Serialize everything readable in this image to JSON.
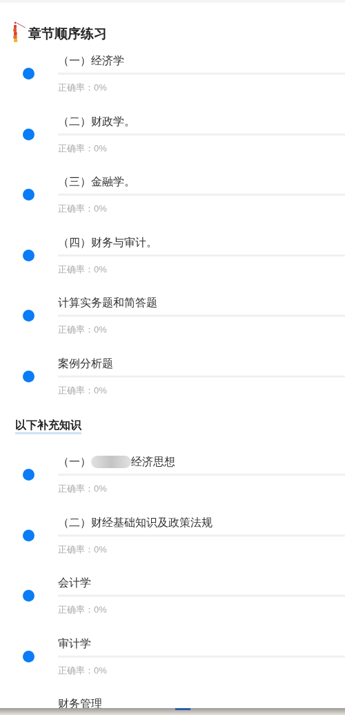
{
  "header": {
    "title": "章节顺序练习"
  },
  "chapters": [
    {
      "title_parts": [
        "（一）经济学"
      ],
      "track": {
        "level": 0
      },
      "accuracy": "正确率：0%"
    },
    {
      "title_parts": [
        "（二）财政学。"
      ],
      "track": {
        "level": 0
      },
      "accuracy": "正确率：0%"
    },
    {
      "title_parts": [
        "（三）金融学。"
      ],
      "track": {
        "level": 0
      },
      "accuracy": "正确率：0%"
    },
    {
      "title_parts": [
        "（四）财务与审计。"
      ],
      "track": {
        "level": 0
      },
      "accuracy": "正确率：0%"
    },
    {
      "title_parts": [
        "计算实务题和简答题"
      ],
      "track": {
        "level": 0
      },
      "accuracy": "正确率：0%"
    },
    {
      "title_parts": [
        "案例分析题"
      ],
      "track": {
        "level": 0
      },
      "accuracy": "正确率：0%"
    }
  ],
  "supplement": {
    "title": "以下补充知识",
    "chapters": [
      {
        "title_parts": [
          "（一）",
          "经济思想"
        ],
        "track": {
          "level": 0
        },
        "accuracy": "正确率：0%"
      },
      {
        "title_parts": [
          "（二）财经基础知识及政策法规"
        ],
        "track": {
          "level": 0
        },
        "accuracy": "正确率：0%"
      },
      {
        "title_parts": [
          "会计学"
        ],
        "track": {
          "level": 0
        },
        "accuracy": "正确率：0%"
      },
      {
        "title_parts": [
          "审计学"
        ],
        "track": {
          "level": 0
        },
        "accuracy": "正确率：0%"
      },
      {
        "title_parts": [
          "财务管理"
        ]
      }
    ]
  }
}
